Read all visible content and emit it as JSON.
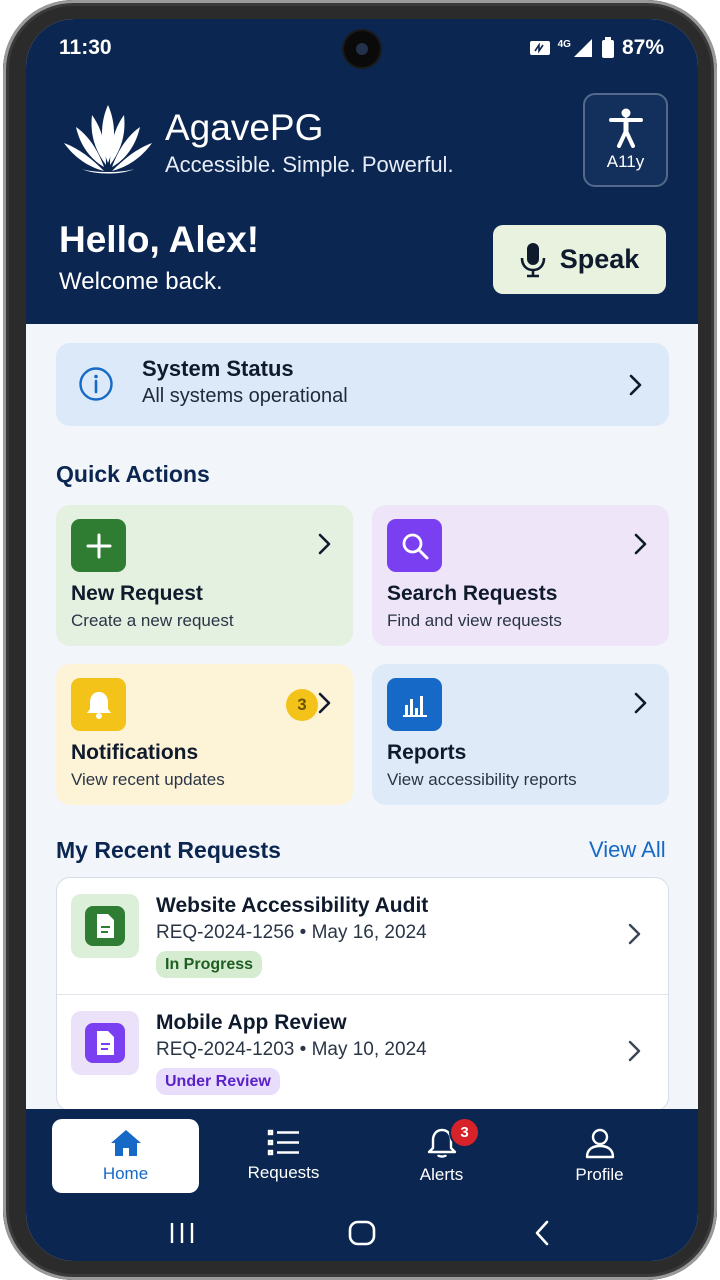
{
  "status_bar": {
    "time": "11:30",
    "network": "4G",
    "battery": "87%"
  },
  "header": {
    "app_name": "AgavePG",
    "tagline": "Accessible. Simple. Powerful.",
    "a11y_label": "A11y",
    "greeting": "Hello, Alex!",
    "welcome": "Welcome back.",
    "speak_label": "Speak"
  },
  "system_status": {
    "title": "System Status",
    "subtitle": "All systems operational"
  },
  "quick_actions": {
    "title": "Quick Actions",
    "items": [
      {
        "title": "New Request",
        "subtitle": "Create a new request",
        "icon": "plus-icon"
      },
      {
        "title": "Search Requests",
        "subtitle": "Find and view requests",
        "icon": "search-icon"
      },
      {
        "title": "Notifications",
        "subtitle": "View recent updates",
        "icon": "bell-icon",
        "count": "3"
      },
      {
        "title": "Reports",
        "subtitle": "View accessibility reports",
        "icon": "bar-chart-icon"
      }
    ]
  },
  "recent_requests": {
    "title": "My Recent Requests",
    "view_all": "View All",
    "items": [
      {
        "title": "Website Accessibility Audit",
        "meta": "REQ-2024-1256 • May 16, 2024",
        "status": "In Progress"
      },
      {
        "title": "Mobile App Review",
        "meta": "REQ-2024-1203 • May 10, 2024",
        "status": "Under Review"
      }
    ]
  },
  "bottom_nav": {
    "items": [
      {
        "label": "Home",
        "icon": "home-icon"
      },
      {
        "label": "Requests",
        "icon": "list-icon"
      },
      {
        "label": "Alerts",
        "icon": "bell-icon",
        "badge": "3"
      },
      {
        "label": "Profile",
        "icon": "user-icon"
      }
    ]
  },
  "colors": {
    "header_bg": "#0b2650",
    "accent_blue": "#1669c7",
    "green": "#2e7d32",
    "purple": "#7a3ff0",
    "yellow": "#f3c31a",
    "alert_red": "#d8222a"
  }
}
